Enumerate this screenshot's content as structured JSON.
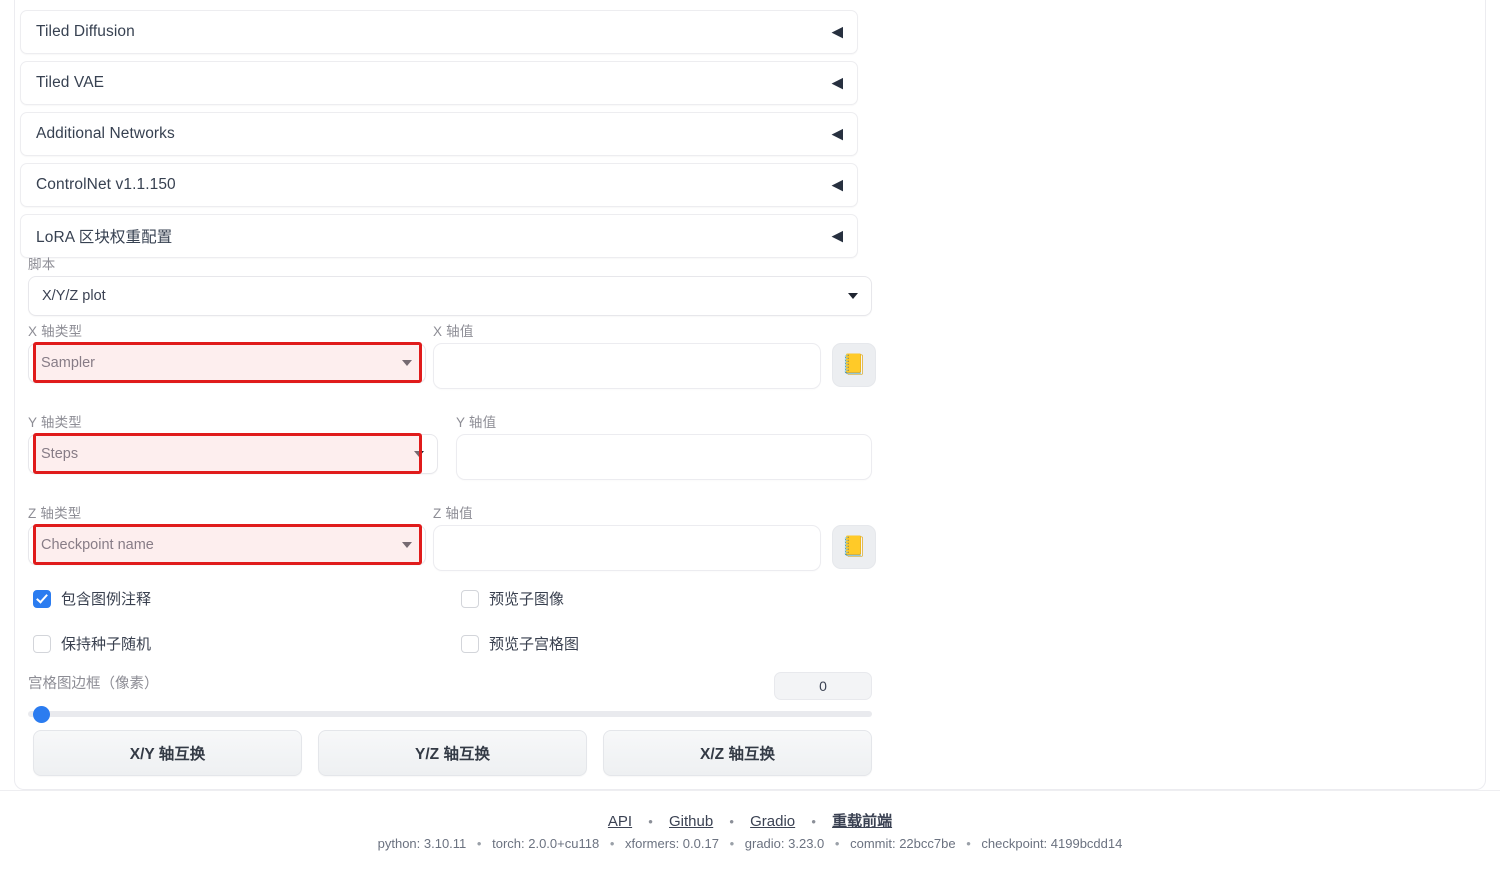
{
  "accordions": [
    {
      "label": "Tiled Diffusion",
      "arrow": "left-triangle-icon"
    },
    {
      "label": "Tiled VAE",
      "arrow": "left-triangle-icon"
    },
    {
      "label": "Additional Networks",
      "arrow": "left-triangle-icon"
    },
    {
      "label": "ControlNet v1.1.150",
      "arrow": "left-triangle-icon"
    },
    {
      "label": "LoRA 区块权重配置",
      "arrow": "left-triangle-icon"
    }
  ],
  "arrow_glyph": "◀",
  "script": {
    "label": "脚本",
    "value": "X/Y/Z plot"
  },
  "axes": [
    {
      "type_label": "X 轴类型",
      "type_value": "Sampler",
      "value_label": "X 轴值",
      "value_text": "",
      "value_placeholder": "",
      "has_ledger_button": true,
      "ledger_icon": "📒",
      "highlighted": true
    },
    {
      "type_label": "Y 轴类型",
      "type_value": "Steps",
      "value_label": "Y 轴值",
      "value_text": "",
      "value_placeholder": "",
      "has_ledger_button": false,
      "ledger_icon": "📒",
      "highlighted": true
    },
    {
      "type_label": "Z 轴类型",
      "type_value": "Checkpoint name",
      "value_label": "Z 轴值",
      "value_text": "",
      "value_placeholder": "",
      "has_ledger_button": true,
      "ledger_icon": "📒",
      "highlighted": true
    }
  ],
  "checkboxes": [
    {
      "label": "包含图例注释",
      "checked": true
    },
    {
      "label": "预览子图像",
      "checked": false
    },
    {
      "label": "保持种子随机",
      "checked": false
    },
    {
      "label": "预览子宫格图",
      "checked": false
    }
  ],
  "slider": {
    "label": "宫格图边框（像素）",
    "value": "0",
    "min": 0,
    "max": 500,
    "percent": 0
  },
  "swap_buttons": [
    {
      "label": "X/Y 轴互换"
    },
    {
      "label": "Y/Z 轴互换"
    },
    {
      "label": "X/Z 轴互换"
    }
  ],
  "footer": {
    "links": [
      {
        "label": "API",
        "strong": false
      },
      {
        "label": "Github",
        "strong": false
      },
      {
        "label": "Gradio",
        "strong": false
      },
      {
        "label": "重载前端",
        "strong": true
      }
    ],
    "separator": "•",
    "versions": [
      "python: 3.10.11",
      "torch: 2.0.0+cu118",
      "xformers: 0.0.17",
      "gradio: 3.23.0",
      "commit: 22bcc7be",
      "checkpoint: 4199bcdd14"
    ]
  },
  "colors": {
    "highlight_border": "#e01b1b",
    "highlight_fill": "#fad4d4",
    "accent": "#2b7cf0"
  }
}
